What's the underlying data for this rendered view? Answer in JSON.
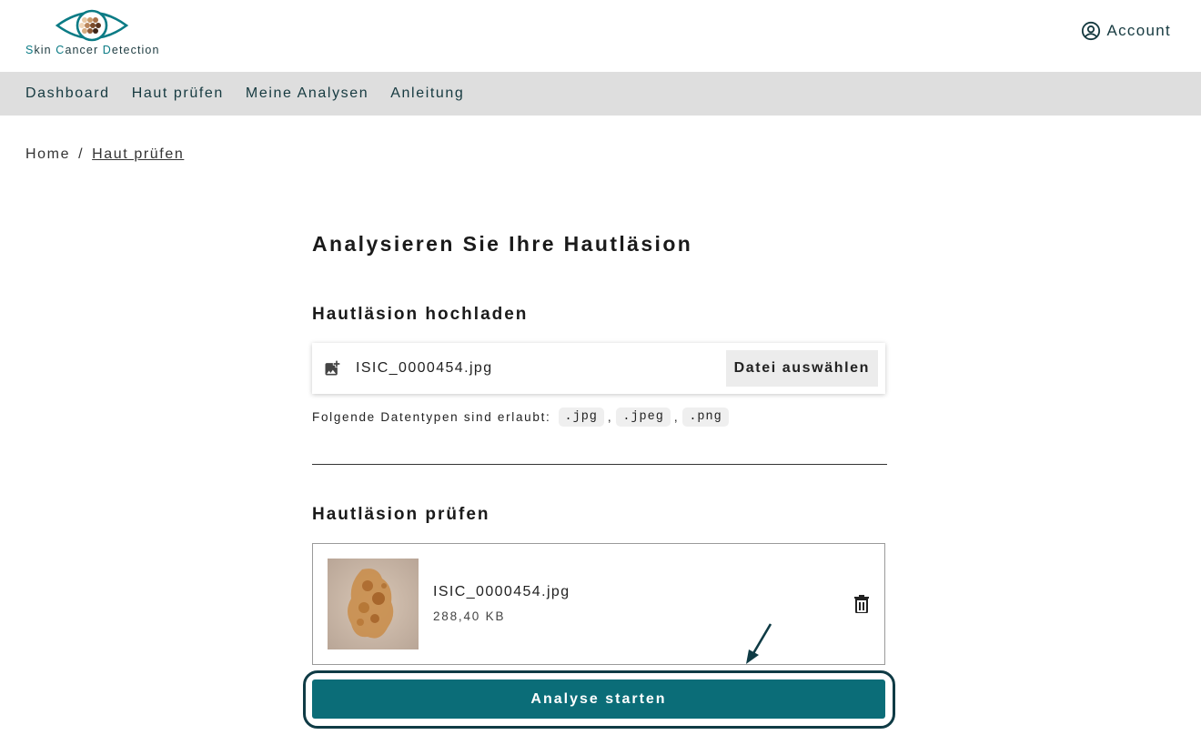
{
  "brand": {
    "name_letters": [
      {
        "text": "S",
        "accent": true
      },
      {
        "text": "kin ",
        "accent": false
      },
      {
        "text": "C",
        "accent": true
      },
      {
        "text": "ancer ",
        "accent": false
      },
      {
        "text": "D",
        "accent": true
      },
      {
        "text": "etection",
        "accent": false
      }
    ],
    "accent_color": "#0b7b85"
  },
  "header": {
    "account_label": "Account",
    "account_icon": "user-circle-icon"
  },
  "nav": {
    "items": [
      {
        "label": "Dashboard"
      },
      {
        "label": "Haut prüfen"
      },
      {
        "label": "Meine Analysen"
      },
      {
        "label": "Anleitung"
      }
    ]
  },
  "breadcrumb": {
    "home": "Home",
    "separator": "/",
    "current": "Haut prüfen"
  },
  "page": {
    "title": "Analysieren Sie Ihre Hautläsion"
  },
  "upload": {
    "section_title": "Hautläsion hochladen",
    "selected_file": "ISIC_0000454.jpg",
    "choose_button": "Datei auswählen",
    "allowed_label": "Folgende Datentypen sind erlaubt:",
    "allowed_types": [
      ".jpg",
      ".jpeg",
      ".png"
    ],
    "type_separator": ","
  },
  "review": {
    "section_title": "Hautläsion prüfen",
    "file": {
      "name": "ISIC_0000454.jpg",
      "size": "288,40 KB"
    },
    "delete_icon": "trash-icon"
  },
  "actions": {
    "start_label": "Analyse starten",
    "primary_color": "#0b6d78",
    "highlight_color": "#0f3b45"
  }
}
